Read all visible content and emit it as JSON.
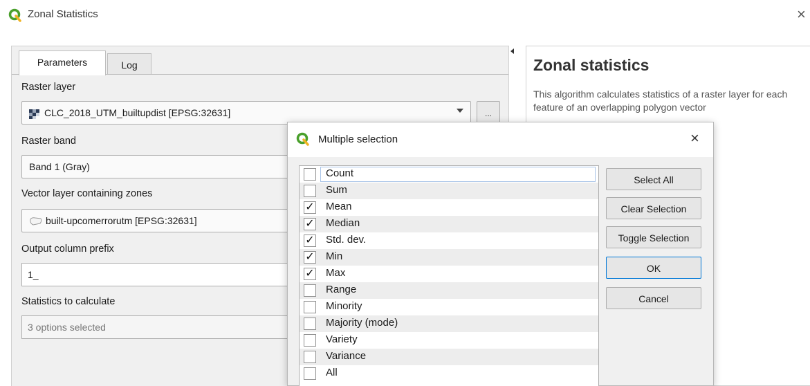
{
  "window": {
    "title": "Zonal Statistics",
    "close_glyph": "×",
    "icon": "qgis-logo-icon",
    "brand_color": "#4aa02c"
  },
  "tabs": [
    {
      "label": "Parameters",
      "active": true
    },
    {
      "label": "Log",
      "active": false
    }
  ],
  "form": {
    "raster_layer": {
      "label": "Raster layer",
      "value": "CLC_2018_UTM_builtupdist [EPSG:32631]",
      "browse_label": "..."
    },
    "raster_band": {
      "label": "Raster band",
      "value": "Band 1 (Gray)"
    },
    "vector_layer": {
      "label": "Vector layer containing zones",
      "value": "built-upcomerrorutm [EPSG:32631]"
    },
    "output_prefix": {
      "label": "Output column prefix",
      "value": "1_"
    },
    "statistics": {
      "label": "Statistics to calculate",
      "value": "3 options selected"
    }
  },
  "help": {
    "title": "Zonal statistics",
    "text": "This algorithm calculates statistics of a raster layer for each feature of an overlapping polygon vector"
  },
  "dialog": {
    "title": "Multiple selection",
    "close_glyph": "×",
    "check_glyph": "✓",
    "options": [
      {
        "label": "Count",
        "checked": false
      },
      {
        "label": "Sum",
        "checked": false
      },
      {
        "label": "Mean",
        "checked": true
      },
      {
        "label": "Median",
        "checked": true
      },
      {
        "label": "Std. dev.",
        "checked": true
      },
      {
        "label": "Min",
        "checked": true
      },
      {
        "label": "Max",
        "checked": true
      },
      {
        "label": "Range",
        "checked": false
      },
      {
        "label": "Minority",
        "checked": false
      },
      {
        "label": "Majority (mode)",
        "checked": false
      },
      {
        "label": "Variety",
        "checked": false
      },
      {
        "label": "Variance",
        "checked": false
      },
      {
        "label": "All",
        "checked": false
      }
    ],
    "buttons": {
      "select_all": "Select All",
      "clear_selection": "Clear Selection",
      "toggle_selection": "Toggle Selection",
      "ok": "OK",
      "cancel": "Cancel"
    },
    "focus_color": "#0078d7"
  }
}
